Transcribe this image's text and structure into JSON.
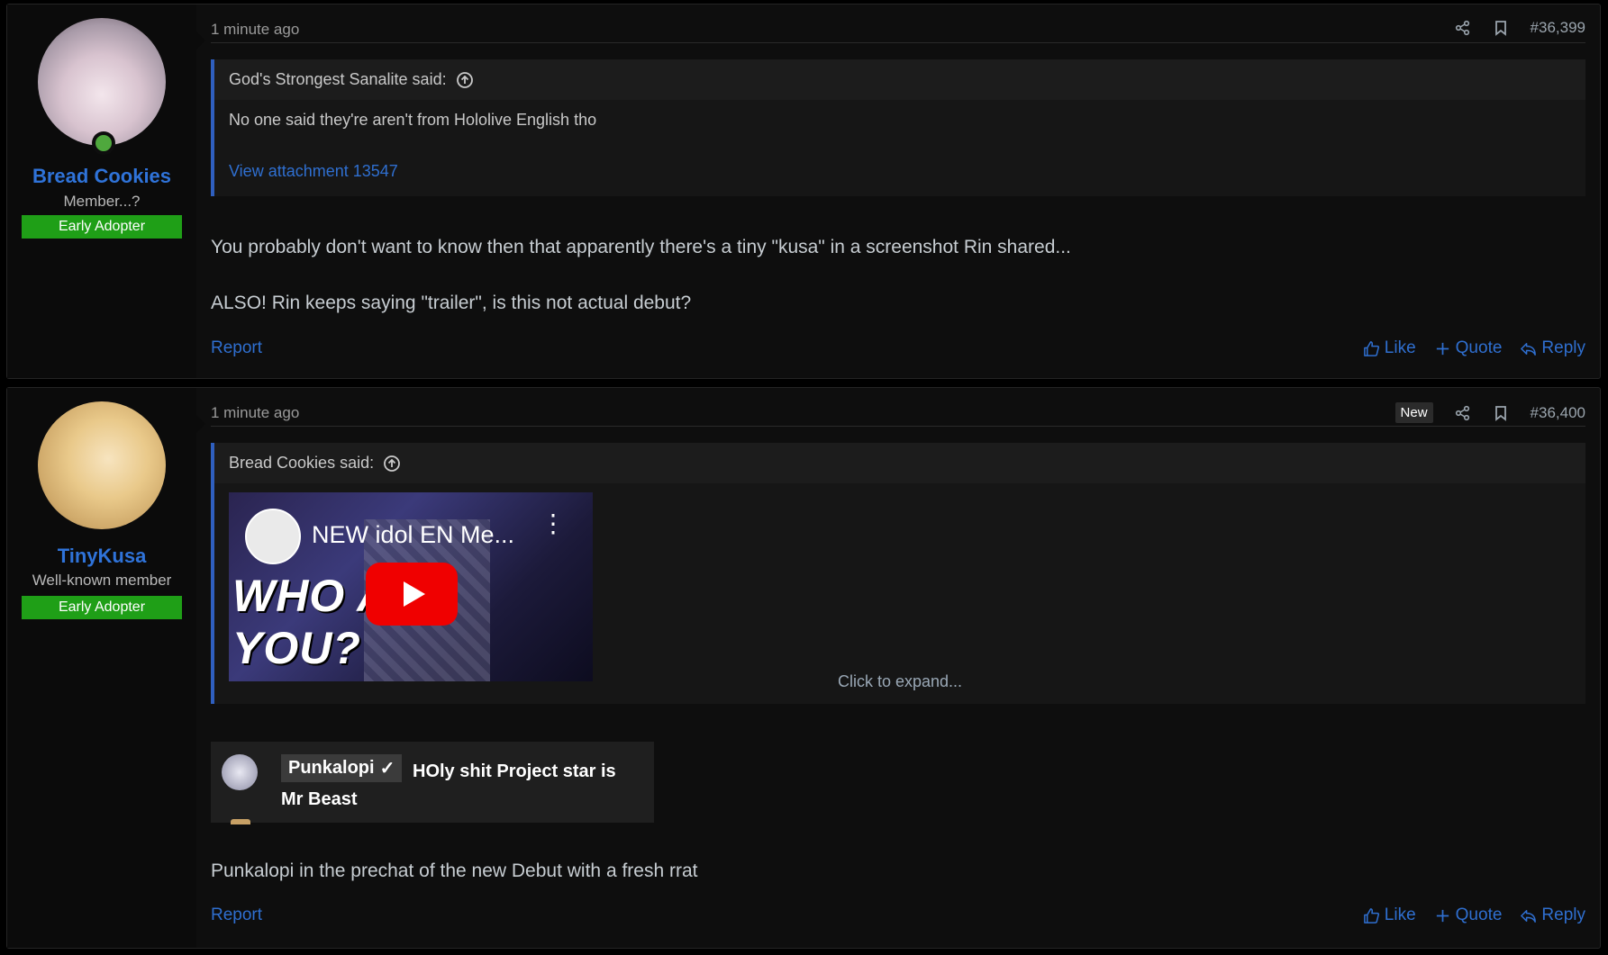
{
  "posts": [
    {
      "author": "Bread Cookies",
      "user_title": "Member...?",
      "banner": "Early Adopter",
      "online": true,
      "timestamp": "1 minute ago",
      "post_number": "#36,399",
      "quote": {
        "author_line": "God's Strongest Sanalite said:",
        "text": "No one said they're aren't from Hololive English tho",
        "attachment_link": "View attachment 13547"
      },
      "message": [
        "You probably don't want to know then that apparently there's a tiny \"kusa\" in a screenshot Rin shared...",
        "ALSO! Rin keeps saying \"trailer\", is this not actual debut?"
      ],
      "footer": {
        "report": "Report",
        "like": "Like",
        "quote": "Quote",
        "reply": "Reply"
      }
    },
    {
      "author": "TinyKusa",
      "user_title": "Well-known member",
      "banner": "Early Adopter",
      "timestamp": "1 minute ago",
      "new_badge": "New",
      "post_number": "#36,400",
      "quote": {
        "author_line": "Bread Cookies said:",
        "video_title": "NEW idol EN Me...",
        "video_overlay": "WHO ARE YOU?",
        "expand": "Click to expand..."
      },
      "chat_embed": {
        "name": "Punkalopi",
        "text": "HOly shit Project star is Mr Beast"
      },
      "message": "Punkalopi in the prechat of the new Debut with a fresh rrat",
      "footer": {
        "report": "Report",
        "like": "Like",
        "quote": "Quote",
        "reply": "Reply"
      }
    }
  ],
  "colors": {
    "link": "#2f6fd0",
    "username": "#2f73d9",
    "banner": "#1f9f17",
    "quote_border": "#2f5fbf",
    "youtube_red": "#f00000"
  },
  "icons": [
    "share-icon",
    "bookmark-icon",
    "arrow-up-circle-icon",
    "thumbs-up-icon",
    "plus-icon",
    "reply-icon",
    "play-icon",
    "verified-check-icon"
  ]
}
